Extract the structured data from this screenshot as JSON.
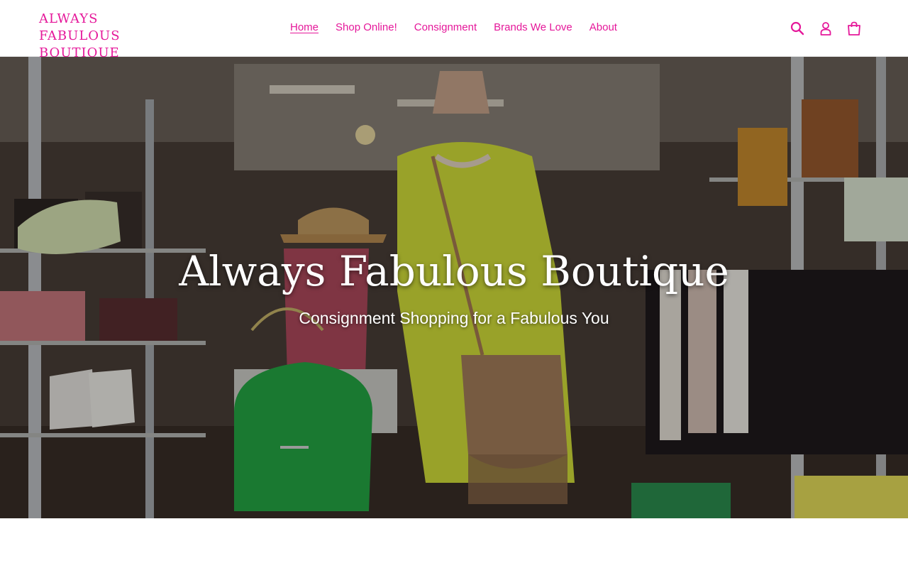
{
  "brand": {
    "logo_text": "ALWAYS FABULOUS BOUTIQUE",
    "color": "#e5189a"
  },
  "nav": {
    "items": [
      {
        "label": "Home",
        "active": true
      },
      {
        "label": "Shop Online!"
      },
      {
        "label": "Consignment"
      },
      {
        "label": "Brands We Love"
      },
      {
        "label": "About"
      }
    ]
  },
  "header_icons": {
    "search": "search-icon",
    "account": "account-icon",
    "cart": "cart-icon"
  },
  "hero": {
    "title": "Always Fabulous Boutique",
    "subtitle": "Consignment Shopping for a Fabulous You",
    "image": "boutique-storefront-photo"
  }
}
